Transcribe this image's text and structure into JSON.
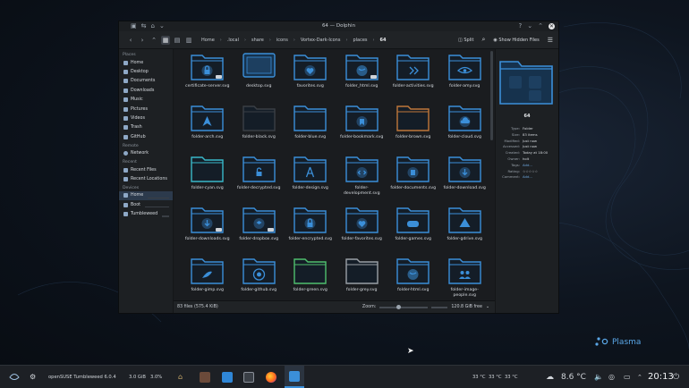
{
  "window": {
    "title": "64 — Dolphin",
    "toolbar": {
      "breadcrumb": [
        "Home",
        ".local",
        "share",
        "icons",
        "Vortex-Dark-Icons",
        "places",
        "64"
      ],
      "split_label": "Split",
      "hidden_files_label": "Show Hidden Files"
    },
    "places": {
      "sections": [
        {
          "title": "Places",
          "items": [
            "Home",
            "Desktop",
            "Documents",
            "Downloads",
            "Music",
            "Pictures",
            "Videos",
            "Trash",
            "GitHub"
          ]
        },
        {
          "title": "Remote",
          "items": [
            "Network"
          ]
        },
        {
          "title": "Recent",
          "items": [
            "Recent Files",
            "Recent Locations"
          ]
        },
        {
          "title": "Devices",
          "items": [
            "Home",
            "Boot",
            "Tumbleweed"
          ]
        }
      ]
    },
    "files": [
      {
        "name": "certificate-server.svg",
        "glyph": "lock-icon",
        "badge": true
      },
      {
        "name": "desktop.svg",
        "glyph": "monitor-icon",
        "badge": false
      },
      {
        "name": "favorites.svg",
        "glyph": "heart-icon",
        "badge": false
      },
      {
        "name": "folder_html.svg",
        "glyph": "globe-icon",
        "badge": true
      },
      {
        "name": "folder-activities.svg",
        "glyph": "activities-icon",
        "badge": false
      },
      {
        "name": "folder-amy.svg",
        "glyph": "eye-icon",
        "badge": false
      },
      {
        "name": "folder-arch.svg",
        "glyph": "arch-icon",
        "badge": false
      },
      {
        "name": "folder-black.svg",
        "glyph": "none",
        "badge": false
      },
      {
        "name": "folder-blue.svg",
        "glyph": "none",
        "badge": false
      },
      {
        "name": "folder-bookmark.svg",
        "glyph": "bookmark-icon",
        "badge": false
      },
      {
        "name": "folder-brown.svg",
        "glyph": "none",
        "badge": false
      },
      {
        "name": "folder-cloud.svg",
        "glyph": "cloud-icon",
        "badge": false
      },
      {
        "name": "folder-cyan.svg",
        "glyph": "none",
        "badge": false
      },
      {
        "name": "folder-decrypted.svg",
        "glyph": "unlock-icon",
        "badge": false
      },
      {
        "name": "folder-design.svg",
        "glyph": "compass-icon",
        "badge": false
      },
      {
        "name": "folder-development.svg",
        "glyph": "code-icon",
        "badge": false
      },
      {
        "name": "folder-documents.svg",
        "glyph": "document-icon",
        "badge": false
      },
      {
        "name": "folder-download.svg",
        "glyph": "download-icon",
        "badge": false
      },
      {
        "name": "folder-downloads.svg",
        "glyph": "download-icon",
        "badge": true
      },
      {
        "name": "folder-dropbox.svg",
        "glyph": "dropbox-icon",
        "badge": true
      },
      {
        "name": "folder-encrypted.svg",
        "glyph": "lock-icon",
        "badge": false
      },
      {
        "name": "folder-favorites.svg",
        "glyph": "heart-icon",
        "badge": false
      },
      {
        "name": "folder-games.svg",
        "glyph": "gamepad-icon",
        "badge": false
      },
      {
        "name": "folder-gdrive.svg",
        "glyph": "drive-icon",
        "badge": false
      },
      {
        "name": "folder-gimp.svg",
        "glyph": "gimp-icon",
        "badge": false
      },
      {
        "name": "folder-github.svg",
        "glyph": "github-icon",
        "badge": false
      },
      {
        "name": "folder-green.svg",
        "glyph": "none",
        "badge": false
      },
      {
        "name": "folder-grey.svg",
        "glyph": "none",
        "badge": false
      },
      {
        "name": "folder-html.svg",
        "glyph": "globe-icon",
        "badge": false
      },
      {
        "name": "folder-image-people.svg",
        "glyph": "people-icon",
        "badge": false
      }
    ],
    "folder_colors": {
      "default": "#3b8fd9",
      "black": "#3a3f45",
      "brown": "#c0773a",
      "cyan": "#39b8c9",
      "green": "#4fbf6e",
      "grey": "#9aa0a6"
    },
    "status": {
      "count": "83 files (575.4 KiB)",
      "zoom_label": "Zoom:",
      "free_space": "120.8 GiB free"
    },
    "info": {
      "title": "64",
      "fields": [
        {
          "key": "Type:",
          "value": "Folder"
        },
        {
          "key": "Size:",
          "value": "83 items"
        },
        {
          "key": "Modified:",
          "value": "Just now"
        },
        {
          "key": "Accessed:",
          "value": "Just now"
        },
        {
          "key": "Created:",
          "value": "Today at 18:00"
        },
        {
          "key": "Owner:",
          "value": "holt"
        },
        {
          "key": "Tags:",
          "value": "Add..."
        },
        {
          "key": "Rating:",
          "value": "☆☆☆☆☆"
        },
        {
          "key": "Comment:",
          "value": "Add..."
        }
      ]
    }
  },
  "desktop": {
    "plasma_label": "Plasma"
  },
  "taskbar": {
    "distro": "openSUSE Tumbleweed 6.0.4",
    "mem": "3.0 GiB",
    "cpu": "3.0%",
    "temps": [
      "33 °C",
      "33 °C",
      "33 °C"
    ],
    "weather": "8.6 °C",
    "clock": "20:13"
  }
}
